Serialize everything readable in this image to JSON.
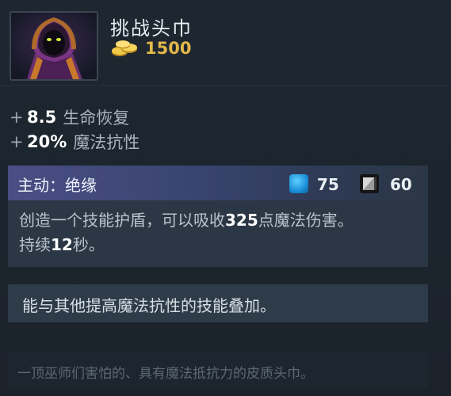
{
  "item": {
    "name": "挑战头巾",
    "cost": "1500",
    "icon": "hooded-mage-icon"
  },
  "stats": [
    {
      "plus": "+",
      "value": "8.5",
      "label": "生命恢复"
    },
    {
      "plus": "+",
      "value": "20%",
      "label": "魔法抗性"
    }
  ],
  "ability": {
    "title": "主动：绝缘",
    "mana_cost": "75",
    "cooldown": "60",
    "desc_part1": "创造一个技能护盾，可以吸收",
    "desc_value1": "325",
    "desc_part2": "点魔法伤害。",
    "desc_part3": "持续",
    "desc_value2": "12",
    "desc_part4": "秒。"
  },
  "note": "能与其他提高魔法抗性的技能叠加。",
  "lore": "一顶巫师们害怕的、具有魔法抵抗力的皮质头巾。",
  "colors": {
    "gold": "#e2b84a",
    "mana": "#1a8fd8",
    "ability_header": "#4a4e84"
  }
}
